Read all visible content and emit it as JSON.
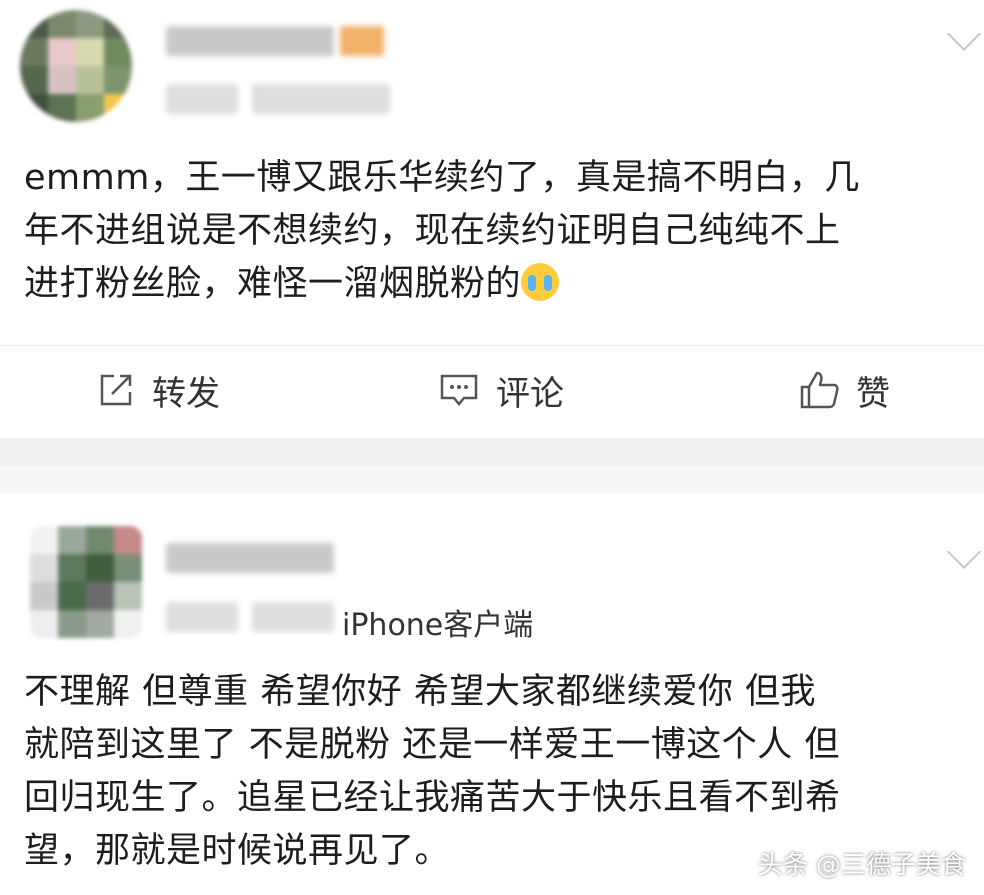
{
  "post1": {
    "content_lines": [
      "emmm，王一博又跟乐华续约了，真是搞不明白，几",
      "年不进组说是不想续约，现在续约证明自己纯纯不上",
      "进打粉丝脸，难怪一溜烟脱粉的"
    ],
    "emoji": "crying-emoji",
    "actions": {
      "repost": "转发",
      "comment": "评论",
      "like": "赞"
    }
  },
  "post2": {
    "source": "iPhone客户端",
    "content_lines": [
      "不理解 但尊重 希望你好 希望大家都继续爱你 但我",
      "就陪到这里了 不是脱粉 还是一样爱王一博这个人 但",
      "回归现生了。追星已经让我痛苦大于快乐且看不到希",
      "望，那就是时候说再见了。"
    ]
  },
  "watermark": "头条 @三德子美食",
  "colors": {
    "text": "#1d1d1d",
    "separator": "#f0f0f0",
    "icon": "#555555"
  }
}
